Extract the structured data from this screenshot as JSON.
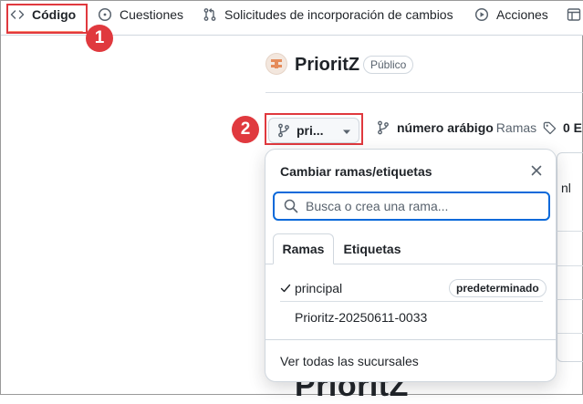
{
  "nav": {
    "items": [
      {
        "label": "Código",
        "icon": "code-icon"
      },
      {
        "label": "Cuestiones",
        "icon": "issue-opened-icon"
      },
      {
        "label": "Solicitudes de incorporación de cambios",
        "icon": "git-pull-request-icon"
      },
      {
        "label": "Acciones",
        "icon": "play-icon"
      }
    ]
  },
  "annotations": {
    "step1": "1",
    "step2": "2"
  },
  "repo": {
    "name": "PrioritZ",
    "visibility": "Público"
  },
  "branch_button": {
    "label": "pri..."
  },
  "branch_stats": {
    "bold": "número arábigo",
    "muted": "Ramas",
    "tags_count": "0 E"
  },
  "background": {
    "title_fragment": "PrioritZ",
    "side_fragment": "nl"
  },
  "popover": {
    "title": "Cambiar ramas/etiquetas",
    "search_placeholder": "Busca o crea una rama...",
    "tabs": [
      {
        "label": "Ramas"
      },
      {
        "label": "Etiquetas"
      }
    ],
    "branches": [
      {
        "name": "principal",
        "selected": true,
        "badge": "predeterminado"
      },
      {
        "name": "Prioritz-20250611-0033",
        "selected": false
      }
    ],
    "footer_link": "Ver todas las sucursales"
  },
  "colors": {
    "accent": "#0969da",
    "annotation_red": "#e0393e",
    "active_underline": "#fd8c73"
  }
}
